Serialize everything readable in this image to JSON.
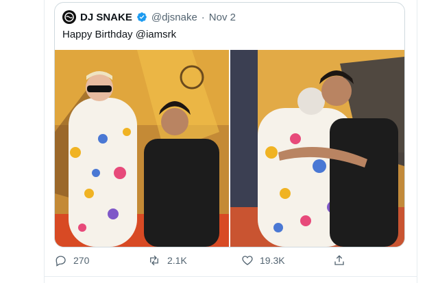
{
  "tweet": {
    "author_name": "DJ SNAKE",
    "handle": "@djsnake",
    "separator": "·",
    "date": "Nov 2",
    "text": "Happy Birthday @iamsrk"
  },
  "media": [
    {
      "icon": "photo-1"
    },
    {
      "icon": "photo-2"
    }
  ],
  "actions": {
    "replies": "270",
    "retweets": "2.1K",
    "likes": "19.3K"
  },
  "colors": {
    "verified": "#1d9bf0",
    "muted": "#536471",
    "border": "#cfd9de"
  }
}
